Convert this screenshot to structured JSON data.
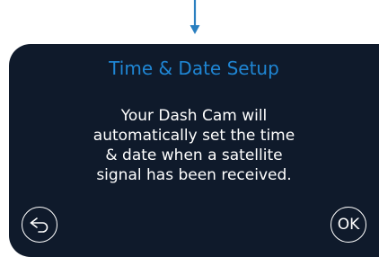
{
  "dialog": {
    "title": "Time & Date Setup",
    "message_lines": [
      "Your Dash Cam will",
      "automatically set the time",
      "& date when a satellite",
      "signal has been received."
    ]
  },
  "buttons": {
    "back_icon": "back-arrow-icon",
    "ok_label": "OK"
  },
  "colors": {
    "screen_background": "#0f1a2b",
    "title": "#1f86d4",
    "text": "#ffffff",
    "pointer_arrow": "#2a7fc0"
  }
}
